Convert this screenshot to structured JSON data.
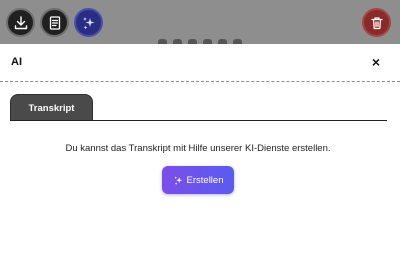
{
  "toolbar": {
    "download_icon": "download-icon",
    "document_icon": "document-icon",
    "ai_icon": "sparkles-icon",
    "delete_icon": "trash-icon"
  },
  "panel": {
    "title": "AI",
    "close_label": "×"
  },
  "tabs": [
    {
      "label": "Transkript",
      "active": true
    }
  ],
  "content": {
    "message": "Du kannst das Transkript mit Hilfe unserer KI-Dienste erstellen.",
    "create_button": "Erstellen"
  },
  "colors": {
    "accent_gradient_start": "#7b4ee8",
    "accent_gradient_end": "#5b5bf0",
    "delete_button": "#8c2929",
    "ai_button": "#2a2e83",
    "tab_active": "#4a4a4a"
  }
}
